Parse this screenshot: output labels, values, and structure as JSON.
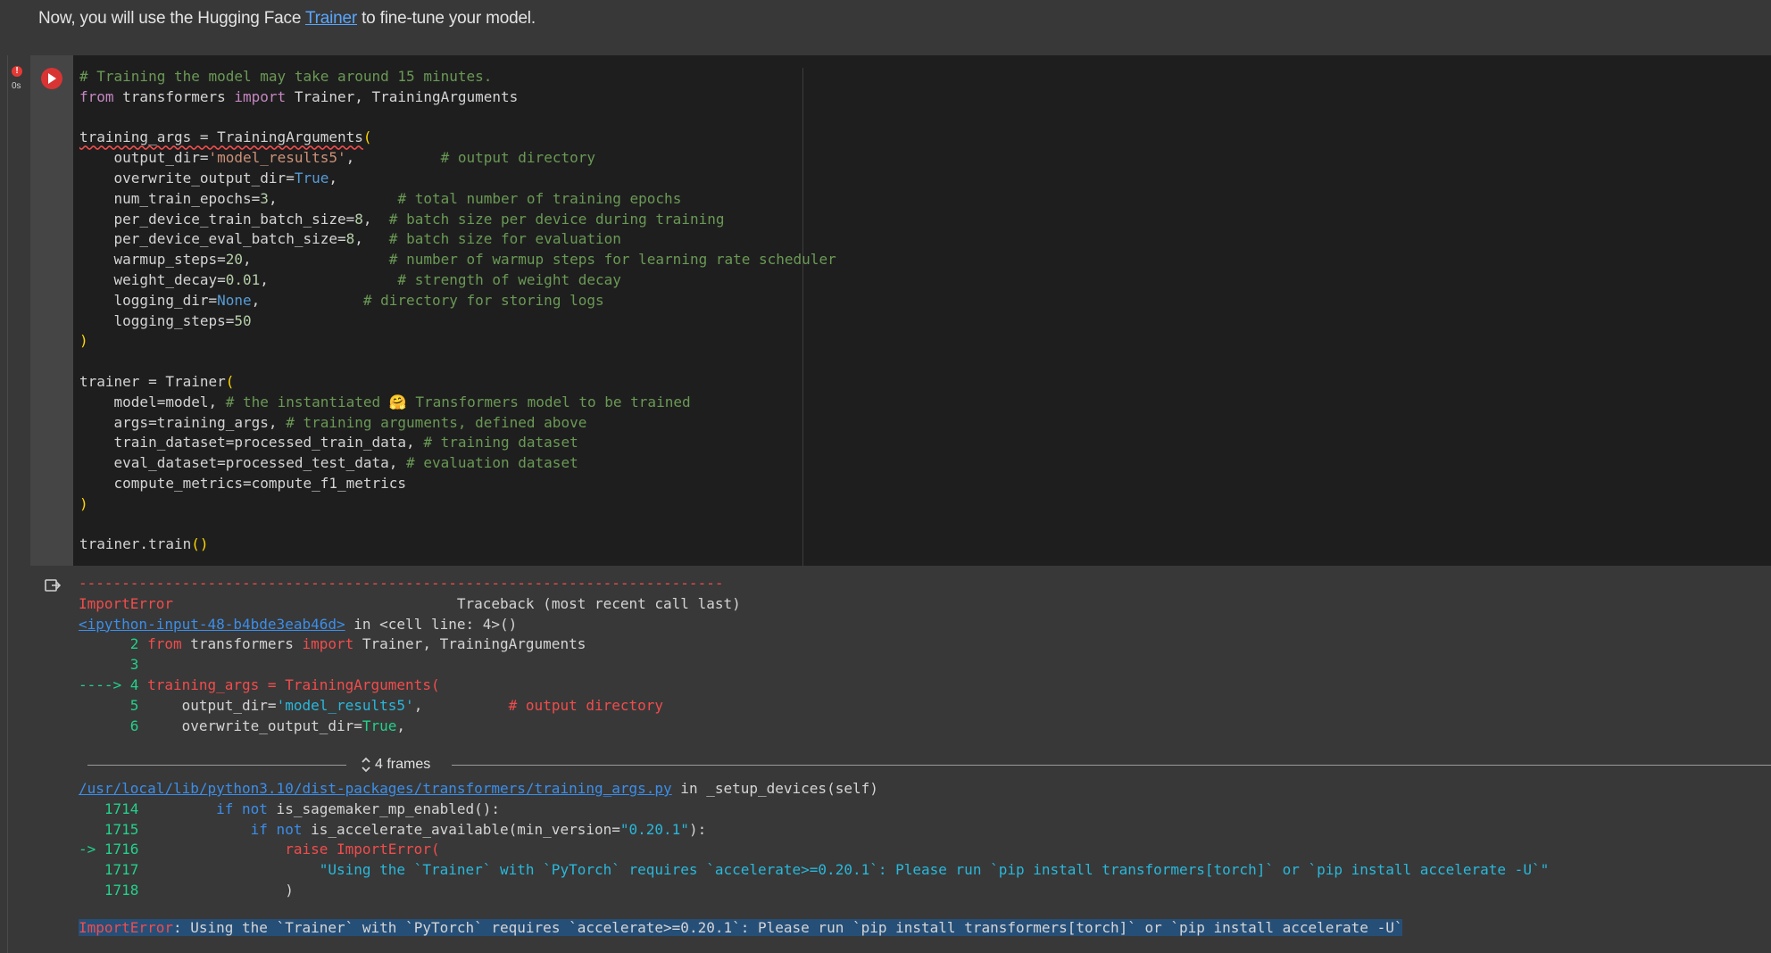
{
  "intro": {
    "before": "Now, you will use the Hugging Face ",
    "link": "Trainer",
    "after": " to fine-tune your model."
  },
  "cell": {
    "status_icon": "!",
    "exec_time": "0s",
    "icons": [
      "error-icon",
      "run-icon",
      "output-icon",
      "chevron-updown-icon"
    ],
    "colors": {
      "run_button": "#d93434",
      "error": "#f14c4c",
      "comment": "#6a9955",
      "keyword": "#c586c0",
      "string": "#ce9178"
    }
  },
  "code": {
    "l1": "# Training the model may take around 15 minutes.",
    "l2_from": "from",
    "l2_mod": " transformers ",
    "l2_import": "import",
    "l2_names": " Trainer, TrainingArguments",
    "l4_a": "training_args = TrainingArguments",
    "l4_p": "(",
    "l5_a": "    output_dir=",
    "l5_s": "'model_results5'",
    "l5_b": ",          ",
    "l5_c": "# output directory",
    "l6_a": "    overwrite_output_dir=",
    "l6_v": "True",
    "l6_b": ",",
    "l7_a": "    num_train_epochs=",
    "l7_v": "3",
    "l7_b": ",              ",
    "l7_c": "# total number of training epochs",
    "l8_a": "    per_device_train_batch_size=",
    "l8_v": "8",
    "l8_b": ",  ",
    "l8_c": "# batch size per device during training",
    "l9_a": "    per_device_eval_batch_size=",
    "l9_v": "8",
    "l9_b": ",   ",
    "l9_c": "# batch size for evaluation",
    "l10_a": "    warmup_steps=",
    "l10_v": "20",
    "l10_b": ",                ",
    "l10_c": "# number of warmup steps for learning rate scheduler",
    "l11_a": "    weight_decay=",
    "l11_v": "0.01",
    "l11_b": ",               ",
    "l11_c": "# strength of weight decay",
    "l12_a": "    logging_dir=",
    "l12_v": "None",
    "l12_b": ",            ",
    "l12_c": "# directory for storing logs",
    "l13_a": "    logging_steps=",
    "l13_v": "50",
    "l14": ")",
    "l16_a": "trainer = Trainer",
    "l16_p": "(",
    "l17_a": "    model=model, ",
    "l17_c": "# the instantiated 🤗 Transformers model to be trained",
    "l18_a": "    args=training_args, ",
    "l18_c": "# training arguments, defined above",
    "l19_a": "    train_dataset=processed_train_data, ",
    "l19_c": "# training dataset",
    "l20_a": "    eval_dataset=processed_test_data, ",
    "l20_c": "# evaluation dataset",
    "l21_a": "    compute_metrics=compute_f1_metrics",
    "l22": ")",
    "l24_a": "trainer.train",
    "l24_p": "()"
  },
  "output": {
    "dashes": "---------------------------------------------------------------------------",
    "err_name": "ImportError",
    "traceback_hdr": "                                 Traceback (most recent call last)",
    "input_link": "<ipython-input-48-b4bde3eab46d>",
    "in_cell": " in <cell line: 4>()",
    "t2_n": "      2 ",
    "t2_from": "from",
    "t2_mod": " transformers ",
    "t2_imp": "import",
    "t2_rest": " Trainer, TrainingArguments",
    "t3_n": "      3",
    "t4_arrow": "----> 4 ",
    "t4_code": "training_args = TrainingArguments(",
    "t5_n": "      5 ",
    "t5_a": "    output_dir=",
    "t5_s": "'model_results5'",
    "t5_b": ",          ",
    "t5_c": "# output directory",
    "t6_n": "      6 ",
    "t6_a": "    overwrite_output_dir=",
    "t6_v": "True",
    "t6_b": ",",
    "frames_label": "4 frames",
    "path_link": "/usr/local/lib/python3.10/dist-packages/transformers/training_args.py",
    "path_in": " in _setup_devices(self)",
    "f1714_n": "   1714 ",
    "f1714_a": "        ",
    "f1714_kw": "if not",
    "f1714_b": " is_sagemaker_mp_enabled():",
    "f1715_n": "   1715 ",
    "f1715_a": "            ",
    "f1715_kw": "if not",
    "f1715_b": " is_accelerate_available(min_version=",
    "f1715_s": "\"0.20.1\"",
    "f1715_c": "):",
    "f1716_n": "-> 1716 ",
    "f1716_code": "                raise ImportError(",
    "f1717_n": "   1717 ",
    "f1717_s": "                    \"Using the `Trainer` with `PyTorch` requires `accelerate>=0.20.1`: Please run `pip install transformers[torch]` or `pip install accelerate -U`\"",
    "f1718_n": "   1718 ",
    "f1718_code": "                )",
    "final_name": "ImportError",
    "final_msg": ": Using the `Trainer` with `PyTorch` requires `accelerate>=0.20.1`: Please run `pip install transformers[torch]` or `pip install accelerate -U`"
  }
}
